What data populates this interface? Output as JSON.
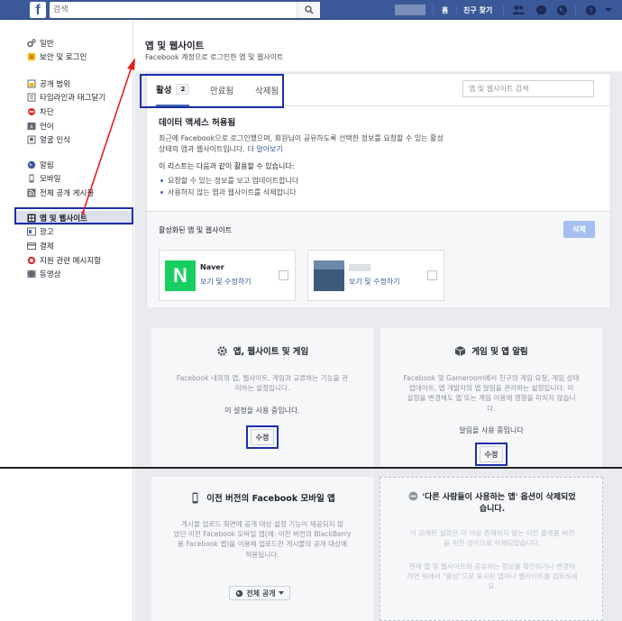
{
  "topbar": {
    "logo": "f",
    "search_placeholder": "검색",
    "home_label": "홈",
    "find_friends_label": "친구 찾기",
    "icons": [
      "friends-icon",
      "messenger-icon",
      "globe-icon",
      "help-icon",
      "dropdown-icon"
    ]
  },
  "sidebar": {
    "group1": [
      {
        "label": "일반",
        "icon": "gear-icon"
      },
      {
        "label": "보안 및 로그인",
        "icon": "shield-icon"
      }
    ],
    "group2": [
      {
        "label": "공개 범위",
        "icon": "lock-icon"
      },
      {
        "label": "타임라인과 태그달기",
        "icon": "timeline-icon"
      },
      {
        "label": "차단",
        "icon": "block-icon"
      },
      {
        "label": "언어",
        "icon": "language-icon"
      },
      {
        "label": "얼굴 인식",
        "icon": "face-icon"
      }
    ],
    "group3": [
      {
        "label": "알림",
        "icon": "globe-icon"
      },
      {
        "label": "모바일",
        "icon": "mobile-icon"
      },
      {
        "label": "전체 공개 게시물",
        "icon": "rss-icon"
      }
    ],
    "group4": [
      {
        "label": "앱 및 웹사이트",
        "icon": "apps-icon",
        "active": true
      },
      {
        "label": "광고",
        "icon": "ads-icon"
      },
      {
        "label": "결제",
        "icon": "payment-icon"
      },
      {
        "label": "지원 관련 메시지함",
        "icon": "support-icon"
      },
      {
        "label": "동영상",
        "icon": "video-icon"
      }
    ]
  },
  "main": {
    "title": "앱 및 웹사이트",
    "subtitle": "Facebook 계정으로 로그인한 앱 및 웹사이트",
    "tabs": [
      {
        "label": "활성",
        "count": "2",
        "active": true
      },
      {
        "label": "만료됨"
      },
      {
        "label": "삭제됨"
      }
    ],
    "app_search_placeholder": "앱 및 웹사이트 검색",
    "data_access": {
      "title": "데이터 액세스 허용됨",
      "body_line1": "최근에 Facebook으로 로그인했으며, 회원님이 공유하도록 선택한 정보를 요청할 수 있는 활성",
      "body_line2": "상태의 앱과 웹사이트입니다.",
      "learn_more": "더 알아보기",
      "list_title": "이 리스트는 다음과 같이 활용할 수 있습니다:",
      "list": [
        "요청할 수 있는 정보를 보고 업데이트합니다",
        "사용하지 않는 앱과 웹사이트를 삭제합니다"
      ]
    },
    "active_apps": {
      "title": "활성화된 앱 및 웹사이트",
      "delete_label": "삭제",
      "apps": [
        {
          "name": "Naver",
          "edit_label": "보기 및 수정하기",
          "icon_letter": "N",
          "icon_color": "#19ce60"
        },
        {
          "name": "",
          "edit_label": "보기 및 수정하기"
        }
      ]
    },
    "cards": {
      "apps_games": {
        "title": "앱, 웹사이트 및 게임",
        "body": [
          "Facebook 내외의 앱, 웹사이트, 게임과 교류하는 기능을 관",
          "리하는 설정입니다."
        ],
        "status": "이 설정을 사용 중입니다.",
        "button": "수정"
      },
      "game_notifications": {
        "title": "게임 및 앱 알림",
        "body": [
          "Facebook 및 Gameroom에서 친구의 게임 요청, 게임 상태",
          "업데이트, 앱 개발자의 앱 알림을 관리하는 설정입니다. 이",
          "설정을 변경해도 앱 또는 게임 이용에 영향을 미치지 않습니",
          "다."
        ],
        "status": "알림을 사용 중입니다",
        "button": "수정"
      },
      "old_mobile": {
        "title": "이전 버전의 Facebook 모바일 앱",
        "body": [
          "게시물 업로드 화면에 공개 대상 설정 기능이 제공되지 않",
          "았던 이전 Facebook 모바일 앱(예: 이전 버전의 BlackBerry",
          "용 Facebook 앱)을 이용해 업로드한 게시물의 공개 대상에",
          "적용됩니다."
        ],
        "audience": "전체 공개"
      },
      "removed_option": {
        "title_line1": "'다른 사람들이 사용하는 앱' 옵션이 삭제되었",
        "title_line2": "습니다.",
        "body1": [
          "이 오래된 설정은 더 이상 존재하지 않는 이전 플랫폼 버전",
          "을 위한 것이므로 삭제되었습니다."
        ],
        "body2": [
          "현재 앱 및 웹사이트와 공유하는 정보를 확인하거나 변경하",
          "려면 위에서 \"활성\"으로 표시된 앱이나 웹사이트를 검토하세",
          "요."
        ]
      }
    }
  },
  "colors": {
    "facebook_blue": "#3b5998",
    "link": "#385898",
    "highlight_box": "#1c2ea8",
    "annotation_arrow": "#e02020"
  }
}
